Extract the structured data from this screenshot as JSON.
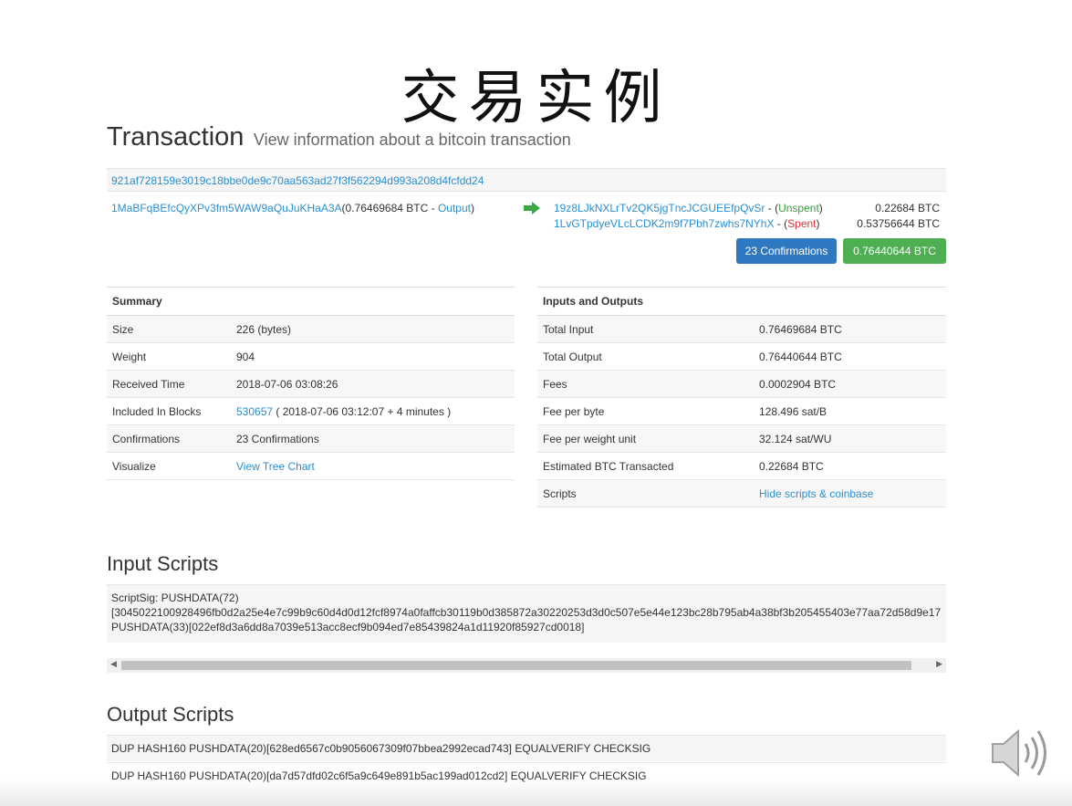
{
  "slide_title": "交易实例",
  "heading": {
    "title": "Transaction",
    "subtitle": "View information about a bitcoin transaction"
  },
  "tx_hash": "921af728159e3019c18bbe0de9c70aa563ad27f3f562294d993a208d4fcfdd24",
  "input": {
    "address": "1MaBFqBEfcQyXPv3fm5WAW9aQuJuKHaA3A",
    "amount_open": "(0.76469684 BTC - ",
    "output_link": "Output",
    "amount_close": ")"
  },
  "outputs": [
    {
      "address": "19z8LJkNXLrTv2QK5jgTncJCGUEEfpQvSr",
      "sep": " - (",
      "status": "Unspent",
      "close": ")",
      "amount": "0.22684 BTC"
    },
    {
      "address": "1LvGTpdyeVLcLCDK2m9f7Pbh7zwhs7NYhX",
      "sep": " - (",
      "status": "Spent",
      "close": ")",
      "amount": "0.53756644 BTC"
    }
  ],
  "badges": {
    "confirmations": "23 Confirmations",
    "total": "0.76440644 BTC"
  },
  "summary": {
    "header": "Summary",
    "size_k": "Size",
    "size_v": "226 (bytes)",
    "weight_k": "Weight",
    "weight_v": "904",
    "received_k": "Received Time",
    "received_v": "2018-07-06 03:08:26",
    "blocks_k": "Included In Blocks",
    "blocks_link": "530657",
    "blocks_rest": " ( 2018-07-06 03:12:07 + 4 minutes )",
    "conf_k": "Confirmations",
    "conf_v": "23 Confirmations",
    "visualize_k": "Visualize",
    "visualize_link": "View Tree Chart"
  },
  "io_table": {
    "header": "Inputs and Outputs",
    "total_input_k": "Total Input",
    "total_input_v": "0.76469684 BTC",
    "total_output_k": "Total Output",
    "total_output_v": "0.76440644 BTC",
    "fees_k": "Fees",
    "fees_v": "0.0002904 BTC",
    "fee_byte_k": "Fee per byte",
    "fee_byte_v": "128.496 sat/B",
    "fee_wu_k": "Fee per weight unit",
    "fee_wu_v": "32.124 sat/WU",
    "est_k": "Estimated BTC Transacted",
    "est_v": "0.22684 BTC",
    "scripts_k": "Scripts",
    "scripts_link": "Hide scripts & coinbase"
  },
  "input_scripts": {
    "title": "Input Scripts",
    "line1": "ScriptSig: PUSHDATA(72)",
    "line2": "[3045022100928496fb0d2a25e4e7c99b9c60d4d0d12fcf8974a0faffcb30119b0d385872a30220253d3d0c507e5e44e123bc28b795ab4a38bf3b205455403e77aa72d58d9e17",
    "line3": "PUSHDATA(33)[022ef8d3a6dd8a7039e513acc8ecf9b094ed7e85439824a1d11920f85927cd0018]"
  },
  "output_scripts": {
    "title": "Output Scripts",
    "rows": [
      "DUP HASH160 PUSHDATA(20)[628ed6567c0b9056067309f07bbea2992ecad743] EQUALVERIFY CHECKSIG",
      "DUP HASH160 PUSHDATA(20)[da7d57dfd02c6f5a9c649e891b5ac199ad012cd2] EQUALVERIFY CHECKSIG"
    ]
  },
  "icons": {
    "arrow": "right-arrow-icon",
    "speaker": "speaker-icon"
  },
  "colors": {
    "link": "#2a8fd0",
    "badge_blue": "#2f78c2",
    "badge_green": "#4eae52",
    "unspent": "#3a9b3a",
    "spent": "#d9363e"
  }
}
